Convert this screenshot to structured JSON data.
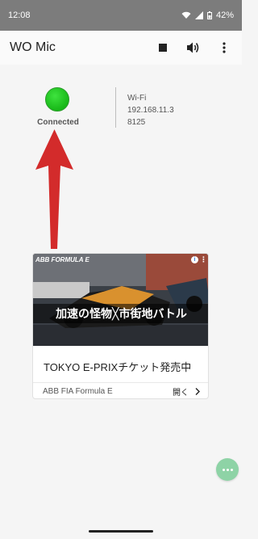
{
  "status_bar": {
    "time": "12:08",
    "battery": "42%",
    "icons": [
      "wifi-icon",
      "signal-icon",
      "battery-icon"
    ]
  },
  "app_bar": {
    "title": "WO Mic",
    "actions": [
      "stop-icon",
      "volume-icon",
      "more-vert-icon"
    ]
  },
  "connection": {
    "state": "Connected",
    "color": "#22c722"
  },
  "network": {
    "type": "Wi-Fi",
    "ip": "192.168.11.3",
    "port": "8125"
  },
  "annotation": {
    "arrow_color": "#d32b2b",
    "points_to": "connection-status"
  },
  "ad": {
    "brand": "ABB FORMULA E",
    "banner": "加速の怪物╳市街地バトル",
    "headline": "TOKYO E-PRIXチケット発売中",
    "advertiser": "ABB FIA Formula E",
    "cta": "開く",
    "info_label": "i"
  },
  "fab": {
    "icon": "chat-icon",
    "color": "#8ed3a6"
  }
}
